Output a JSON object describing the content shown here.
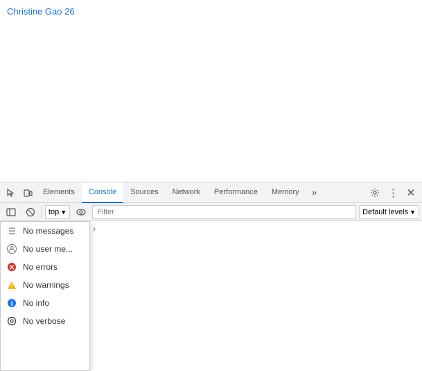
{
  "page": {
    "title": "Christine Gao 26"
  },
  "devtools": {
    "tabs": [
      {
        "label": "Elements",
        "active": false
      },
      {
        "label": "Console",
        "active": true
      },
      {
        "label": "Sources",
        "active": false
      },
      {
        "label": "Network",
        "active": false
      },
      {
        "label": "Performance",
        "active": false
      },
      {
        "label": "Memory",
        "active": false
      }
    ],
    "toolbar": {
      "context": "top",
      "filter_placeholder": "Filter",
      "default_levels": "Default levels"
    },
    "filter_items": [
      {
        "id": "all-messages",
        "icon": "list",
        "label": "No messages"
      },
      {
        "id": "user-messages",
        "icon": "user",
        "label": "No user me..."
      },
      {
        "id": "errors",
        "icon": "error",
        "label": "No errors"
      },
      {
        "id": "warnings",
        "icon": "warning",
        "label": "No warnings"
      },
      {
        "id": "info",
        "icon": "info",
        "label": "No info"
      },
      {
        "id": "verbose",
        "icon": "gear",
        "label": "No verbose"
      }
    ]
  }
}
